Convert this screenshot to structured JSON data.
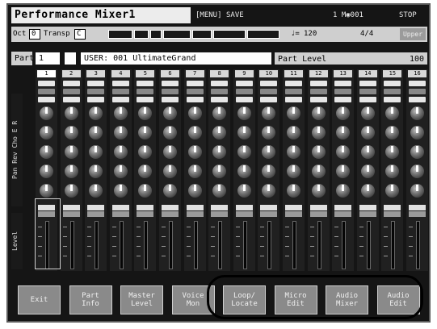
{
  "header": {
    "title": "Performance Mixer1",
    "menu": "[MENU]",
    "menu_label": "SAVE",
    "measure": "1 M◉001",
    "status": "STOP"
  },
  "transport": {
    "oct_label": "Oct",
    "oct_value": "0",
    "transpose_label": "Transp",
    "transpose_value": "C",
    "tempo_label": "♩=",
    "tempo": "120",
    "time_sig": "4/4",
    "lower_label": "Upper"
  },
  "part": {
    "label": "Part",
    "number": "1",
    "patch": "USER: 001 UltimateGrand",
    "level_label": "Part Level",
    "level_value": "100"
  },
  "mixer": {
    "side_label_top": "Pan Rev Cho E R",
    "side_label_bottom": "Level",
    "channels": [
      "1",
      "2",
      "3",
      "4",
      "5",
      "6",
      "7",
      "8",
      "9",
      "10",
      "11",
      "12",
      "13",
      "14",
      "15",
      "16"
    ]
  },
  "buttons": [
    {
      "label": "Exit"
    },
    {
      "label": "Part\nInfo"
    },
    {
      "label": "Master\nLevel"
    },
    {
      "label": "Voice\nMon"
    },
    {
      "label": "Loop/\nLocate"
    },
    {
      "label": "Micro\nEdit"
    },
    {
      "label": "Audio\nMixer"
    },
    {
      "label": "Audio\nEdit"
    }
  ],
  "colors": {
    "screen_bg": "#151515",
    "panel": "#cfcfcf",
    "highlight": "#ffffff"
  }
}
